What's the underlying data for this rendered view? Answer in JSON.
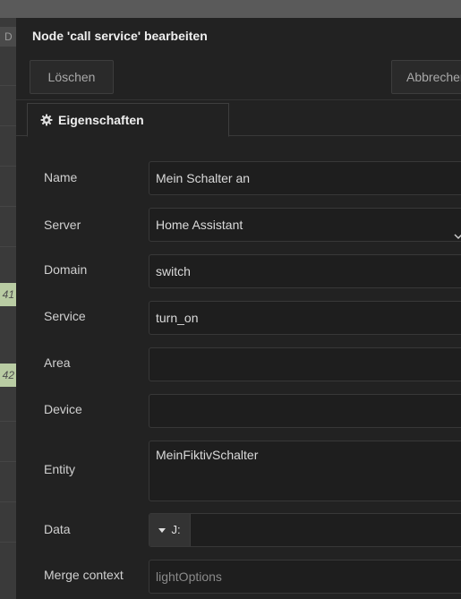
{
  "workspace": {
    "tab_letter": "D",
    "node_labels": [
      "41",
      "42"
    ]
  },
  "tray": {
    "title": "Node 'call service' bearbeiten",
    "buttons": {
      "delete": "Löschen",
      "cancel": "Abbrechen"
    },
    "tab": {
      "label": "Eigenschaften",
      "icon": "gear-icon"
    }
  },
  "form": {
    "name": {
      "label": "Name",
      "value": "Mein Schalter an"
    },
    "server": {
      "label": "Server",
      "value": "Home Assistant"
    },
    "domain": {
      "label": "Domain",
      "value": "switch"
    },
    "service": {
      "label": "Service",
      "value": "turn_on"
    },
    "area": {
      "label": "Area",
      "value": ""
    },
    "device": {
      "label": "Device",
      "value": ""
    },
    "entity": {
      "label": "Entity",
      "value": "MeinFiktivSchalter"
    },
    "data": {
      "label": "Data",
      "type_label": "J:",
      "value": ""
    },
    "merge_context": {
      "label": "Merge context",
      "placeholder": "lightOptions"
    }
  },
  "colors": {
    "tray_bg": "#222222",
    "field_bg": "#1e1e1e",
    "node_green": "#b9cca3"
  }
}
